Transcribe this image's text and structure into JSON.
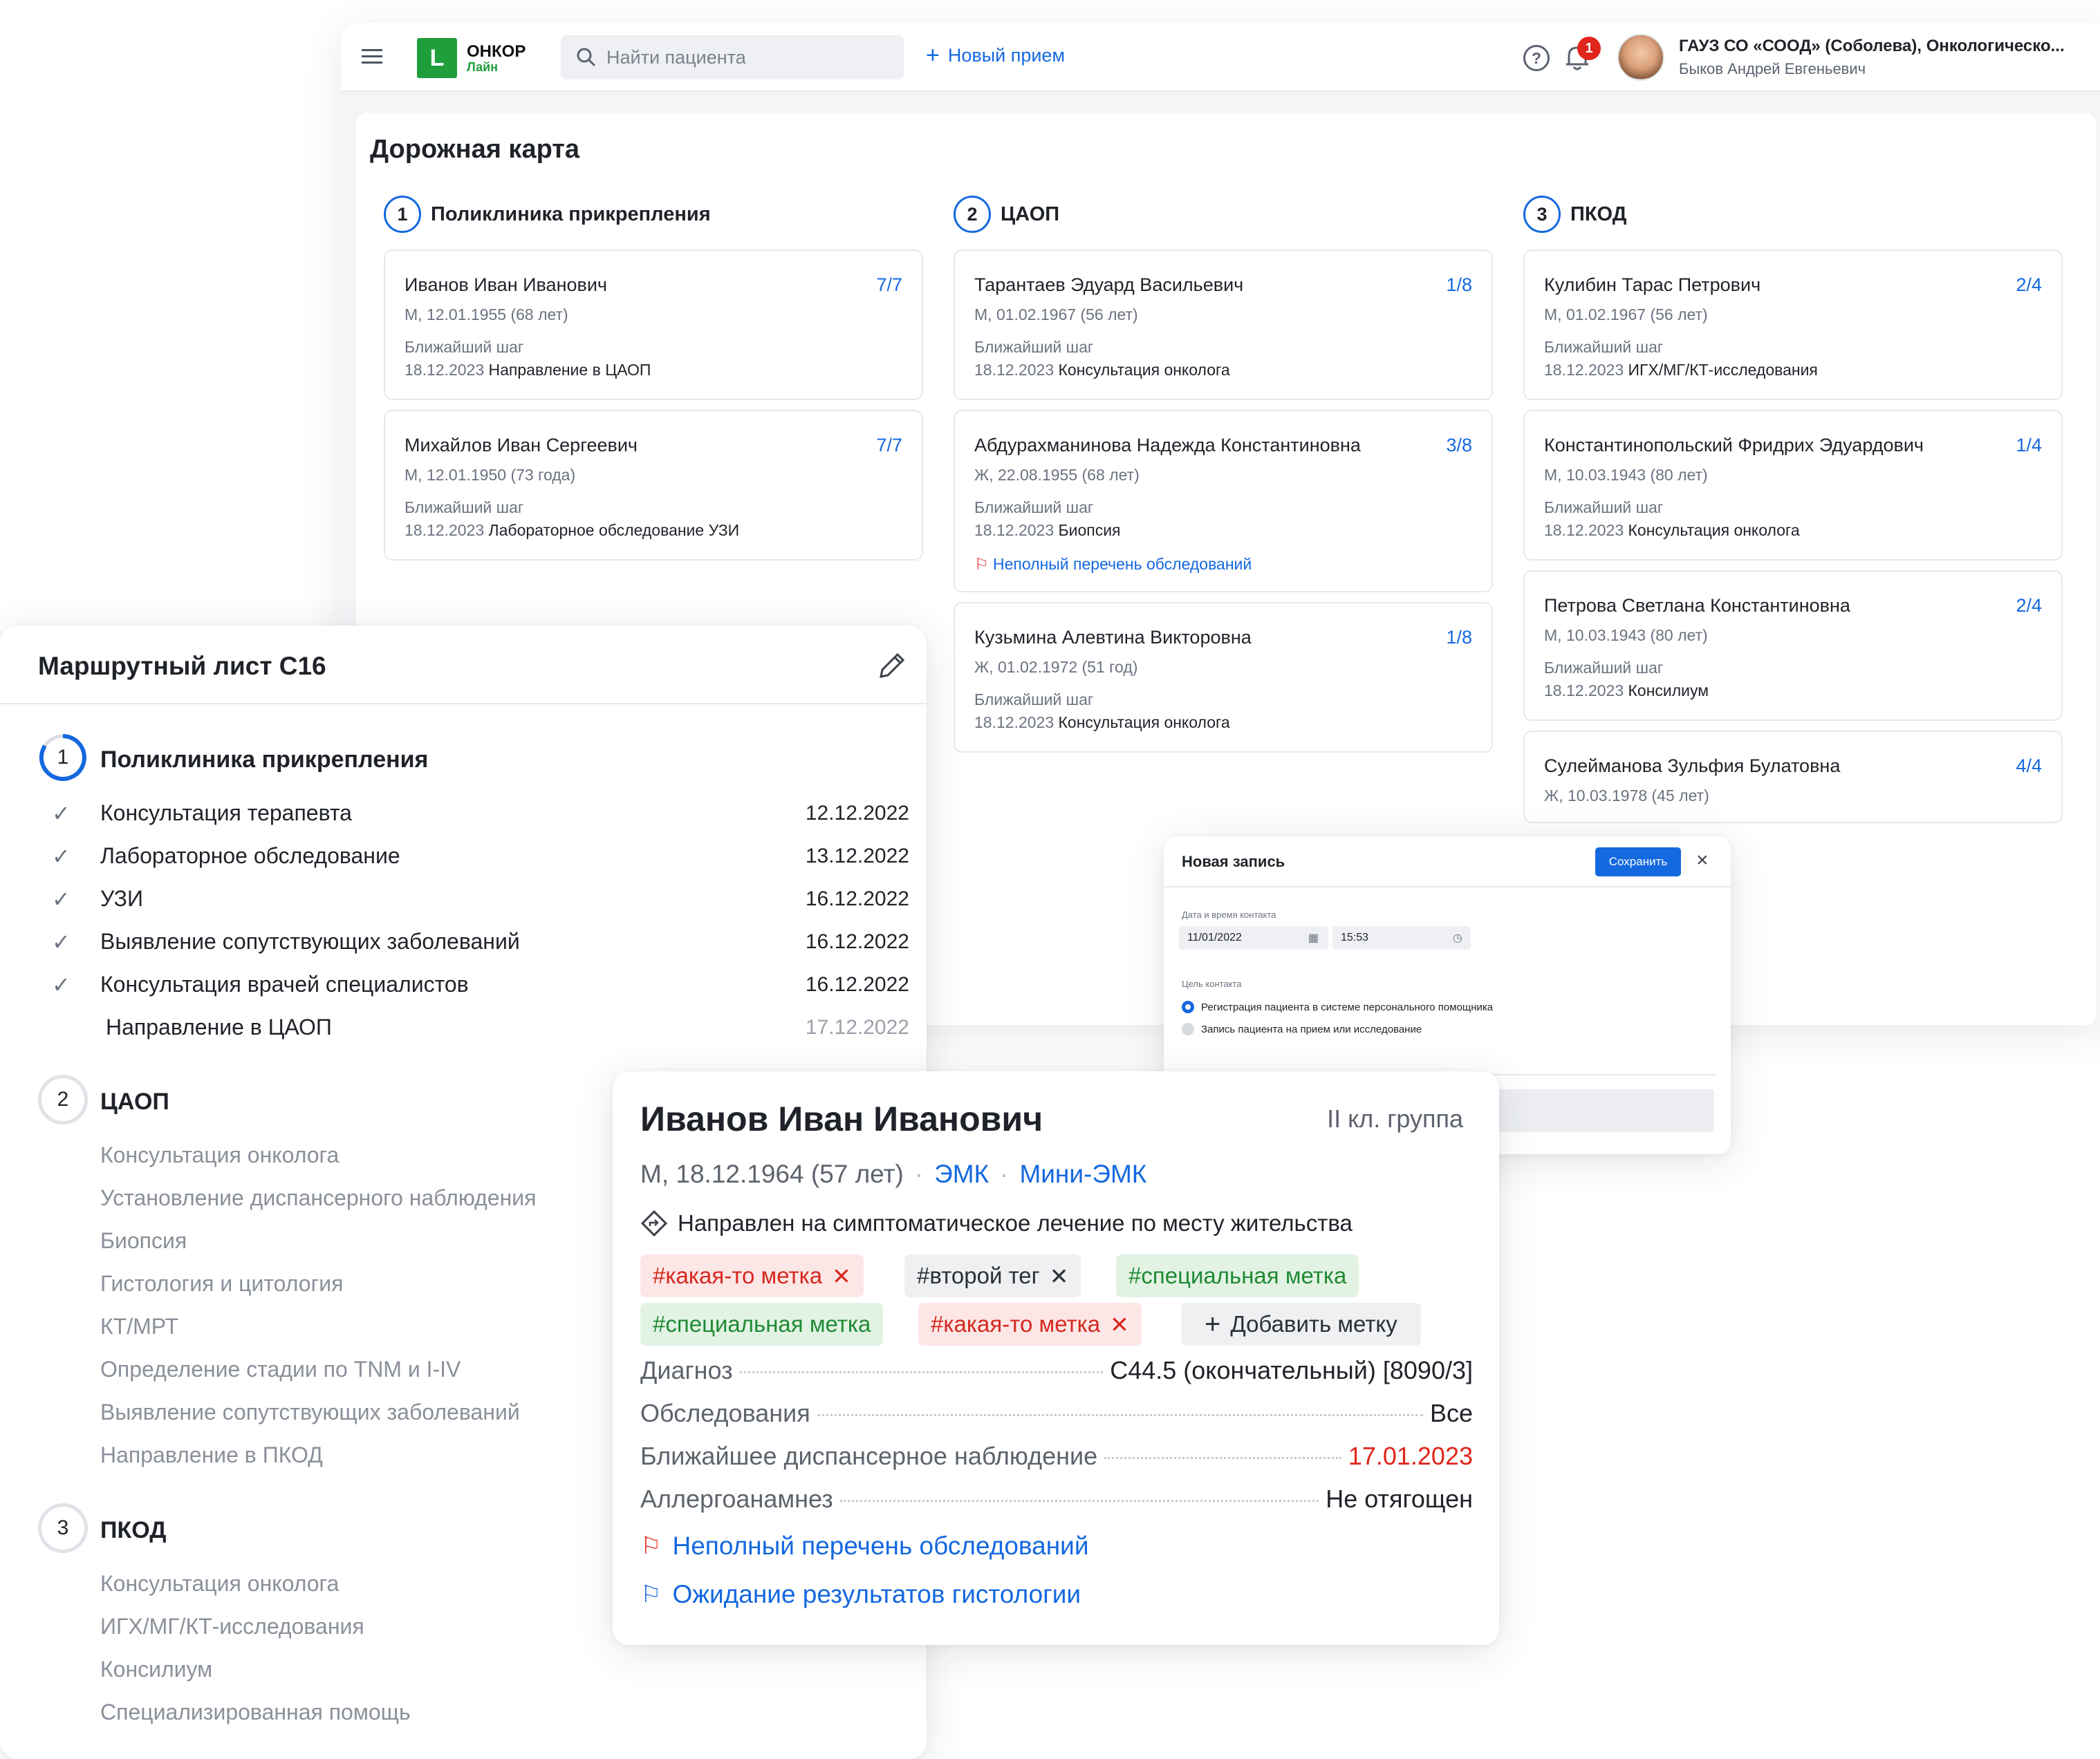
{
  "topbar": {
    "logo_mark": "L",
    "logo_title": "ОНКОР",
    "logo_sub": "Лайн",
    "search_placeholder": "Найти пациента",
    "new_visit": "Новый прием",
    "notif_count": "1",
    "org": "ГАУЗ СО «СООД» (Соболева), Онкологическо...",
    "user": "Быков Андрей Евгеньевич"
  },
  "roadmap": {
    "title": "Дорожная карта",
    "columns": [
      {
        "num": "1",
        "title": "Поликлиника прикрепления",
        "patients": [
          {
            "name": "Иванов Иван Иванович",
            "count": "7/7",
            "info": "М, 12.01.1955 (68 лет)",
            "next_label": "Ближайший шаг",
            "next_date": "18.12.2023",
            "next_step": "Направление в ЦАОП"
          },
          {
            "name": "Михайлов Иван Сергеевич",
            "count": "7/7",
            "info": "М, 12.01.1950 (73 года)",
            "next_label": "Ближайший шаг",
            "next_date": "18.12.2023",
            "next_step": "Лабораторное обследование УЗИ"
          }
        ]
      },
      {
        "num": "2",
        "title": "ЦАОП",
        "patients": [
          {
            "name": "Тарантаев Эдуард Васильевич",
            "count": "1/8",
            "info": "М, 01.02.1967 (56 лет)",
            "next_label": "Ближайший шаг",
            "next_date": "18.12.2023",
            "next_step": "Консультация онколога"
          },
          {
            "name": "Абдурахманинова Надежда Константиновна",
            "count": "3/8",
            "info": "Ж, 22.08.1955 (68 лет)",
            "next_label": "Ближайший шаг",
            "next_date": "18.12.2023",
            "next_step": "Биопсия",
            "flag": "Неполный перечень обследований"
          },
          {
            "name": "Кузьмина Алевтина Викторовна",
            "count": "1/8",
            "info": "Ж, 01.02.1972 (51 год)",
            "next_label": "Ближайший шаг",
            "next_date": "18.12.2023",
            "next_step": "Консультация онколога"
          }
        ]
      },
      {
        "num": "3",
        "title": "ПКОД",
        "patients": [
          {
            "name": "Кулибин Тарас Петрович",
            "count": "2/4",
            "info": "М, 01.02.1967 (56 лет)",
            "next_label": "Ближайший шаг",
            "next_date": "18.12.2023",
            "next_step": "ИГХ/МГ/КТ-исследования"
          },
          {
            "name": "Константинопольский Фридрих Эдуардович",
            "count": "1/4",
            "info": "М, 10.03.1943 (80 лет)",
            "next_label": "Ближайший шаг",
            "next_date": "18.12.2023",
            "next_step": "Консультация онколога"
          },
          {
            "name": "Петрова Светлана Константиновна",
            "count": "2/4",
            "info": "М, 10.03.1943 (80 лет)",
            "next_label": "Ближайший шаг",
            "next_date": "18.12.2023",
            "next_step": "Консилиум"
          },
          {
            "name": "Сулейманова Зульфия Булатовна",
            "count": "4/4",
            "info": "Ж, 10.03.1978 (45 лет)"
          }
        ]
      }
    ]
  },
  "route": {
    "title": "Маршрутный лист С16",
    "stages": [
      {
        "num": "1",
        "title": "Поликлиника прикрепления",
        "items": [
          {
            "label": "Консультация терапевта",
            "date": "12.12.2022"
          },
          {
            "label": "Лабораторное обследование",
            "date": "13.12.2022"
          },
          {
            "label": "УЗИ",
            "date": "16.12.2022"
          },
          {
            "label": "Выявление сопутствующих заболеваний",
            "date": "16.12.2022"
          },
          {
            "label": "Консультация врачей специалистов",
            "date": "16.12.2022"
          },
          {
            "label": "Направление в ЦАОП",
            "date": "17.12.2022"
          }
        ]
      },
      {
        "num": "2",
        "title": "ЦАОП",
        "items": [
          "Консультация онколога",
          "Установление диспансерного наблюдения",
          "Биопсия",
          "Гистология и цитология",
          "КТ/МРТ",
          "Определение стадии по TNM и I-IV",
          "Выявление сопутствующих заболеваний",
          "Направление в ПКОД"
        ]
      },
      {
        "num": "3",
        "title": "ПКОД",
        "items": [
          "Консультация онколога",
          "ИГХ/МГ/КТ-исследования",
          "Консилиум",
          "Специализированная помощь"
        ]
      }
    ]
  },
  "dialog": {
    "title": "Новая запись",
    "save": "Сохранить",
    "datetime_label": "Дата и время контакта",
    "date": "11/01/2022",
    "time": "15:53",
    "goal_label": "Цель контакта",
    "options": [
      "Регистрация пациента в системе персонального помощника",
      "Запись пациента на прием или исследование"
    ]
  },
  "patient": {
    "name": "Иванов Иван Иванович",
    "group": "II кл. группа",
    "info": "М, 18.12.1964 (57 лет)",
    "emk": "ЭМК",
    "mini_emk": "Мини-ЭМК",
    "direction": "Направлен на симптоматическое лечение по месту жительства",
    "tags": [
      "#какая-то метка",
      "#второй тег",
      "#специальная метка",
      "#специальная метка",
      "#какая-то метка"
    ],
    "add_tag": "Добавить метку",
    "details": [
      {
        "label": "Диагноз",
        "value": "С44.5 (окончательный) [8090/3]"
      },
      {
        "label": "Обследования",
        "value": "Все"
      },
      {
        "label": "Ближайшее диспансерное наблюдение",
        "value": "17.01.2023"
      },
      {
        "label": "Аллергоанамнез",
        "value": "Не отягощен"
      }
    ],
    "flags": [
      "Неполный перечень обследований",
      "Ожидание результатов гистологии"
    ]
  },
  "colors": {
    "accent": "#1468e0",
    "brand_green": "#1f9e3c",
    "danger": "#e0251b"
  }
}
